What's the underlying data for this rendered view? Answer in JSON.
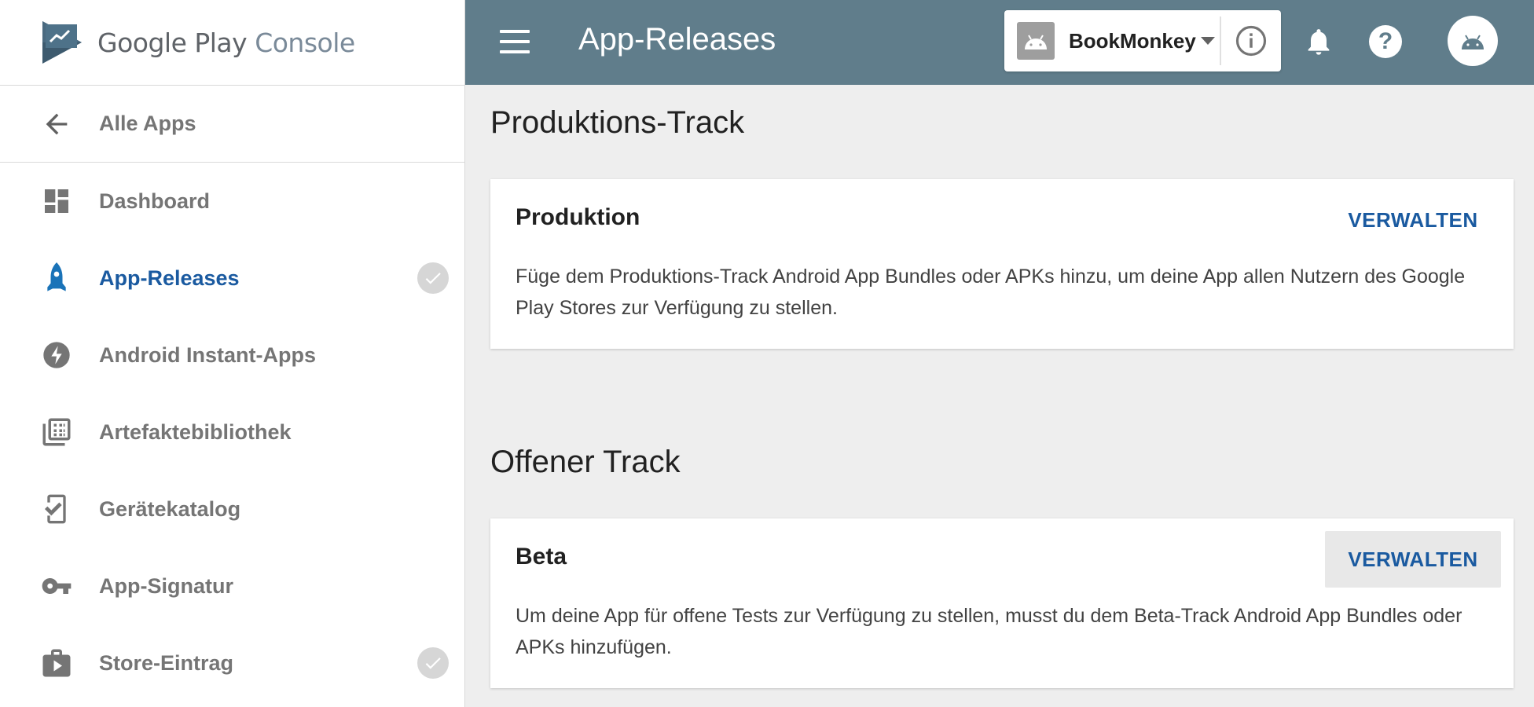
{
  "brand": {
    "google_play": "Google Play",
    "console": "Console"
  },
  "sidebar": {
    "back_label": "Alle Apps",
    "items": [
      {
        "label": "Dashboard",
        "icon": "dashboard-icon"
      },
      {
        "label": "App-Releases",
        "icon": "rocket-icon",
        "active": true,
        "checked": true
      },
      {
        "label": "Android Instant-Apps",
        "icon": "bolt-icon"
      },
      {
        "label": "Artefaktebibliothek",
        "icon": "library-icon"
      },
      {
        "label": "Gerätekatalog",
        "icon": "device-check-icon"
      },
      {
        "label": "App-Signatur",
        "icon": "key-icon"
      },
      {
        "label": "Store-Eintrag",
        "icon": "store-icon",
        "checked": true
      }
    ]
  },
  "topbar": {
    "title": "App-Releases",
    "app_name": "BookMonkey"
  },
  "tracks": [
    {
      "section": "Produktions-Track",
      "card_title": "Produktion",
      "action": "VERWALTEN",
      "text": "Füge dem Produktions-Track Android App Bundles oder APKs hinzu, um deine App allen Nutzern des Google Play Stores zur Verfügung zu stellen."
    },
    {
      "section": "Offener Track",
      "card_title": "Beta",
      "action": "VERWALTEN",
      "text": "Um deine App für offene Tests zur Verfügung zu stellen, musst du dem Beta-Track Android App Bundles oder APKs hinzufügen."
    }
  ],
  "colors": {
    "topbar": "#607d8b",
    "accent": "#1a5aa0",
    "background": "#eeeeee"
  }
}
